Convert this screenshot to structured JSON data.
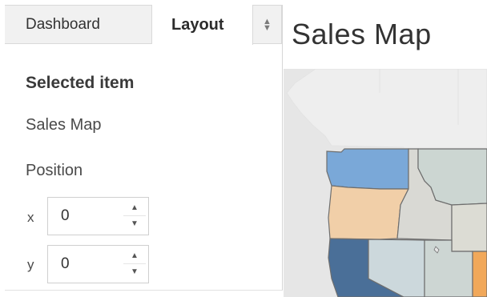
{
  "tabs": {
    "dashboard": "Dashboard",
    "layout": "Layout"
  },
  "panel": {
    "section_heading": "Selected item",
    "item_name": "Sales Map",
    "position_label": "Position",
    "x_label": "x",
    "x_value": "0",
    "y_label": "y",
    "y_value": "0"
  },
  "map": {
    "title": "Sales Map"
  },
  "colors": {
    "washington": "#7aa8d8",
    "oregon": "#f1cfa8",
    "california": "#4a6f98",
    "nevada": "#ccd8dc",
    "idaho": "#d9d9d4",
    "montana": "#ccd6d2",
    "wyoming": "#dcdcd4",
    "utah_arizona": "#cdd6d3",
    "colorado_orange": "#f1a85a",
    "ocean": "#e6e6e6",
    "canada": "#eeeeee"
  }
}
